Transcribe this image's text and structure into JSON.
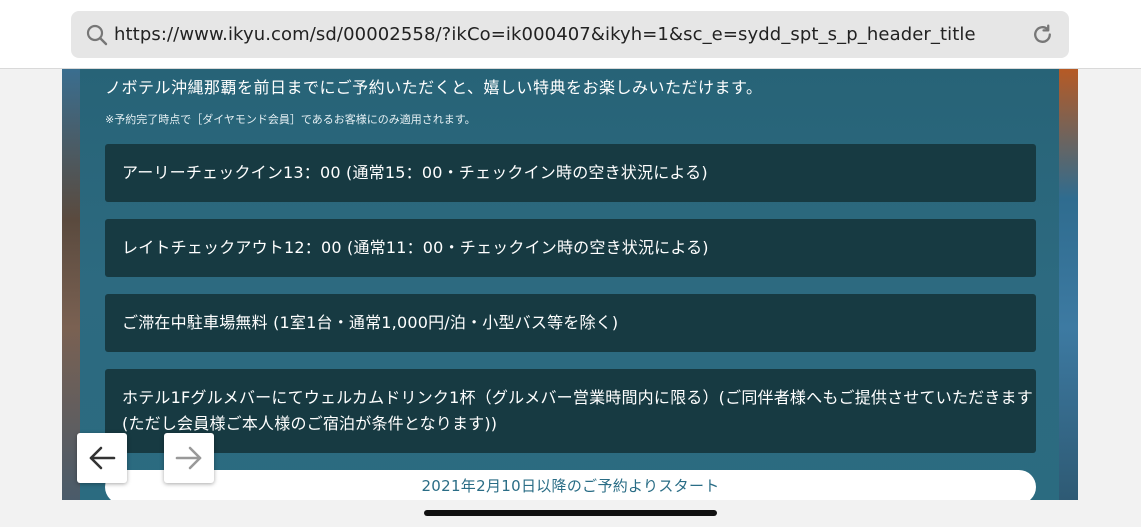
{
  "browser": {
    "url": "https://www.ikyu.com/sd/00002558/?ikCo=ik000407&ikyh=1&sc_e=sydd_spt_s_p_header_title",
    "search_icon": "search-icon",
    "reload_icon": "reload-icon"
  },
  "content": {
    "intro": "ノボテル沖縄那覇を前日までにご予約いただくと、嬉しい特典をお楽しみいただけます。",
    "note": "※予約完了時点で［ダイヤモンド会員］であるお客様にのみ適用されます。",
    "benefits": [
      "アーリーチェックイン13：00 (通常15：00・チェックイン時の空き状況による)",
      "レイトチェックアウト12：00 (通常11：00・チェックイン時の空き状況による)",
      "ご滞在中駐車場無料 (1室1台・通常1,000円/泊・小型バス等を除く)",
      "ホテル1Fグルメバーにてウェルカムドリンク1杯（グルメバー営業時間内に限る）(ご同伴者様へもご提供させていただきます",
      "(ただし会員様ご本人様のご宿泊が条件となります))"
    ],
    "start_label": "2021年2月10日以降のご予約よりスタート"
  },
  "nav": {
    "back_icon": "arrow-left-icon",
    "forward_icon": "arrow-right-icon"
  },
  "colors": {
    "panel": "#2b6b80",
    "benefit_bg": "#173a42",
    "accent_text": "#2a6d86"
  }
}
